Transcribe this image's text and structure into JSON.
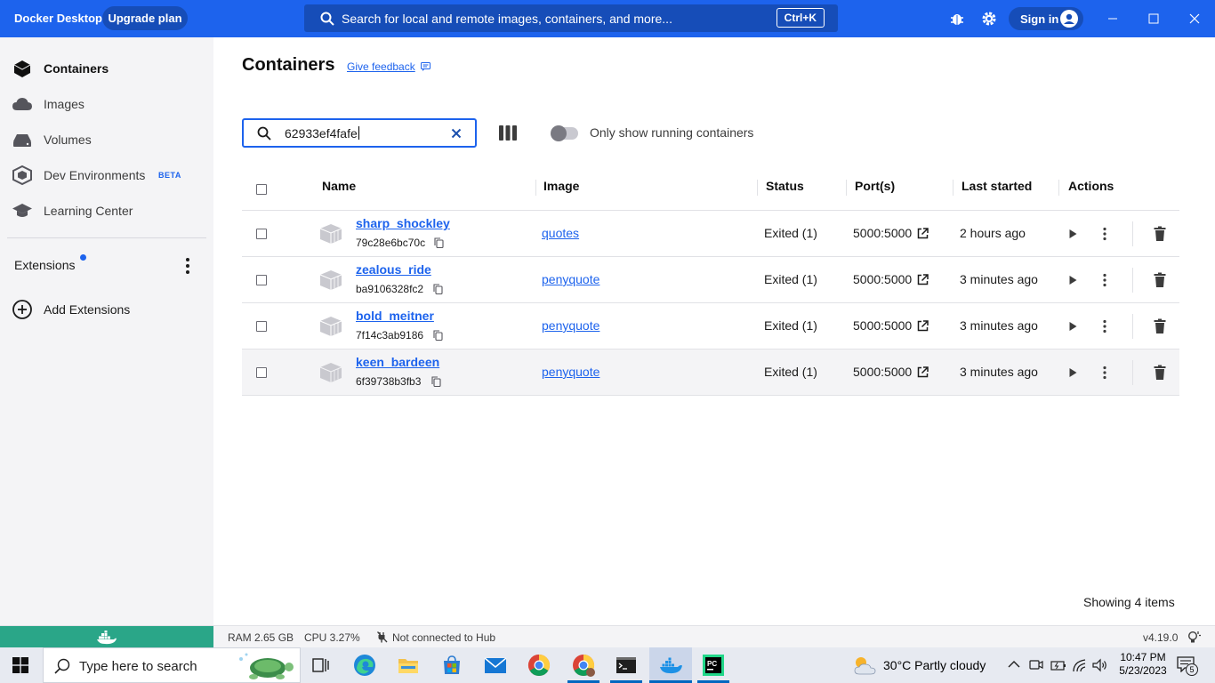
{
  "titlebar": {
    "app_name": "Docker Desktop",
    "upgrade_label": "Upgrade plan",
    "search_placeholder": "Search for local and remote images, containers, and more...",
    "search_shortcut": "Ctrl+K",
    "signin_label": "Sign in"
  },
  "sidebar": {
    "items": [
      {
        "label": "Containers",
        "icon": "containers-icon",
        "active": true
      },
      {
        "label": "Images",
        "icon": "cloud-icon"
      },
      {
        "label": "Volumes",
        "icon": "volume-icon"
      },
      {
        "label": "Dev Environments",
        "icon": "dev-env-icon",
        "badge": "BETA"
      },
      {
        "label": "Learning Center",
        "icon": "graduation-cap-icon"
      }
    ],
    "extensions_label": "Extensions",
    "add_extensions_label": "Add Extensions"
  },
  "main": {
    "title": "Containers",
    "feedback_label": "Give feedback",
    "search_value": "62933ef4fafe",
    "toggle_label": "Only show running containers",
    "toggle_on": false,
    "columns": [
      "Name",
      "Image",
      "Status",
      "Port(s)",
      "Last started",
      "Actions"
    ],
    "rows": [
      {
        "name": "sharp_shockley",
        "id": "79c28e6bc70c",
        "image": "quotes",
        "status": "Exited (1)",
        "port": "5000:5000",
        "last_started": "2 hours ago"
      },
      {
        "name": "zealous_ride",
        "id": "ba9106328fc2",
        "image": "penyquote",
        "status": "Exited (1)",
        "port": "5000:5000",
        "last_started": "3 minutes ago"
      },
      {
        "name": "bold_meitner",
        "id": "7f14c3ab9186",
        "image": "penyquote",
        "status": "Exited (1)",
        "port": "5000:5000",
        "last_started": "3 minutes ago"
      },
      {
        "name": "keen_bardeen",
        "id": "6f39738b3fb3",
        "image": "penyquote",
        "status": "Exited (1)",
        "port": "5000:5000",
        "last_started": "3 minutes ago"
      }
    ],
    "showing": "Showing 4 items"
  },
  "statusbar": {
    "ram": "RAM 2.65 GB",
    "cpu": "CPU 3.27%",
    "hub": "Not connected to Hub",
    "version": "v4.19.0"
  },
  "taskbar": {
    "search_placeholder": "Type here to search",
    "weather": "30°C  Partly cloudy",
    "time": "10:47 PM",
    "date": "5/23/2023",
    "notifications": "5"
  },
  "colors": {
    "brand_blue": "#1d63ed",
    "status_green": "#2aa688"
  }
}
